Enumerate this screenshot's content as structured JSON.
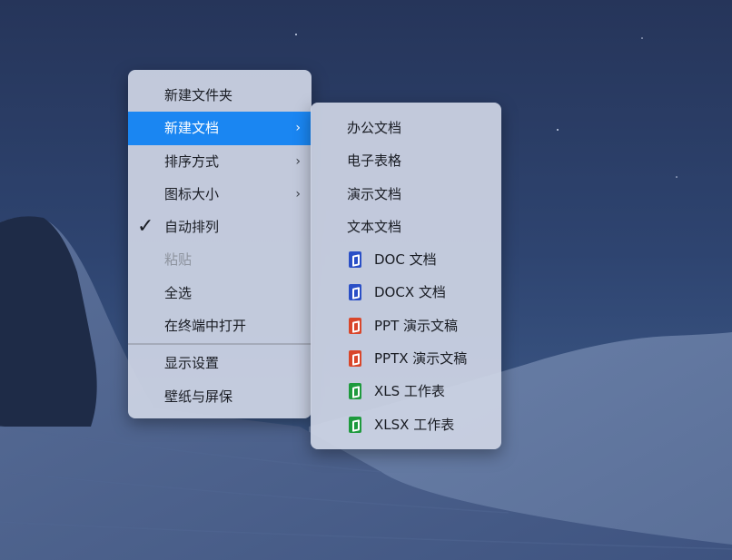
{
  "context_menu": {
    "items": [
      {
        "label": "新建文件夹",
        "state": "normal"
      },
      {
        "label": "新建文档",
        "state": "highlighted",
        "submenu": true
      },
      {
        "label": "排序方式",
        "state": "normal",
        "submenu": true
      },
      {
        "label": "图标大小",
        "state": "normal",
        "submenu": true
      },
      {
        "label": "自动排列",
        "state": "checked"
      },
      {
        "label": "粘贴",
        "state": "disabled"
      },
      {
        "label": "全选",
        "state": "normal"
      },
      {
        "label": "在终端中打开",
        "state": "normal"
      },
      {
        "label": "显示设置",
        "state": "normal"
      },
      {
        "label": "壁纸与屏保",
        "state": "normal"
      }
    ],
    "check_glyph": "✓",
    "chevron_glyph": "›"
  },
  "submenu": {
    "items": [
      {
        "label": "办公文档"
      },
      {
        "label": "电子表格"
      },
      {
        "label": "演示文档"
      },
      {
        "label": "文本文档"
      },
      {
        "label": "DOC 文档",
        "icon": "word-doc-icon",
        "color": "#2a4fc6"
      },
      {
        "label": "DOCX 文档",
        "icon": "word-doc-icon",
        "color": "#2a4fc6"
      },
      {
        "label": "PPT 演示文稿",
        "icon": "powerpoint-icon",
        "color": "#d9462a"
      },
      {
        "label": "PPTX 演示文稿",
        "icon": "powerpoint-icon",
        "color": "#d9462a"
      },
      {
        "label": "XLS 工作表",
        "icon": "excel-icon",
        "color": "#1e9a3d"
      },
      {
        "label": "XLSX 工作表",
        "icon": "excel-icon",
        "color": "#1e9a3d"
      }
    ]
  },
  "colors": {
    "highlight": "#1a86f2",
    "menu_bg": "#cdd4e4",
    "desktop_sky": "#26355a"
  }
}
